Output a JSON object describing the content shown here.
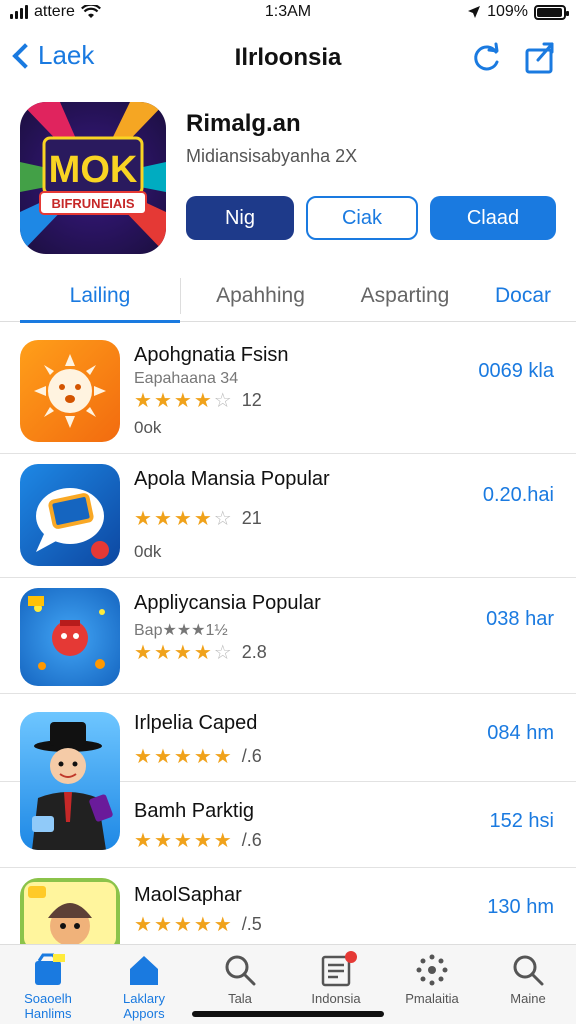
{
  "status": {
    "carrier": "attere",
    "time": "1:3AM",
    "battery": "109%",
    "battery_level": 0.95
  },
  "nav": {
    "back_label": "Laek",
    "title": "Ilrloonsia"
  },
  "app": {
    "name": "Rimalg.an",
    "subtitle": "Midiansisabyanha 2X",
    "icon_text_main": "MOK",
    "icon_text_banner": "BIFRUNEIAIS",
    "buttons": {
      "primary": "Nig",
      "outline": "Ciak",
      "get": "Claad"
    }
  },
  "tabs": [
    "Lailing",
    "Apahhing",
    "Asparting",
    "Docar"
  ],
  "apps": [
    {
      "title": "Apohgnatia Fsisn",
      "meta": "Eapahaana 34",
      "rating_num": "12",
      "sub": "0ok",
      "size": "0069 kla",
      "stars": 4.5
    },
    {
      "title": "Apola Mansia Popular",
      "meta": "",
      "rating_num": "21",
      "sub": "0dk",
      "size": "0.20.hai",
      "stars": 4
    },
    {
      "title": "Appliycansia Popular",
      "meta": "Bap★★★1½",
      "rating_num": "2.8",
      "sub": "",
      "size": "038 har",
      "stars": 4.5
    },
    {
      "title": "Irlpelia Caped",
      "meta": "",
      "rating_num": "/.6",
      "sub": "",
      "size": "084 hm",
      "stars": 5
    },
    {
      "title": "Bamh Parktig",
      "meta": "",
      "rating_num": "/.6",
      "sub": "",
      "size": "152 hsi",
      "stars": 4.5
    },
    {
      "title": "MaolSaphar",
      "meta": "",
      "rating_num": "/.5",
      "sub": "",
      "size": "130 hm",
      "stars": 5
    }
  ],
  "tabbar": [
    {
      "label": "Soaoelh",
      "sub": "Hanlims",
      "icon": "search-store-icon"
    },
    {
      "label": "Laklary",
      "sub": "Appors",
      "icon": "home-icon"
    },
    {
      "label": "Tala",
      "sub": "",
      "icon": "search-icon"
    },
    {
      "label": "Indonsia",
      "sub": "",
      "icon": "news-icon"
    },
    {
      "label": "Pmalaitia",
      "sub": "",
      "icon": "dots-icon"
    },
    {
      "label": "Maine",
      "sub": "",
      "icon": "search-icon"
    }
  ]
}
